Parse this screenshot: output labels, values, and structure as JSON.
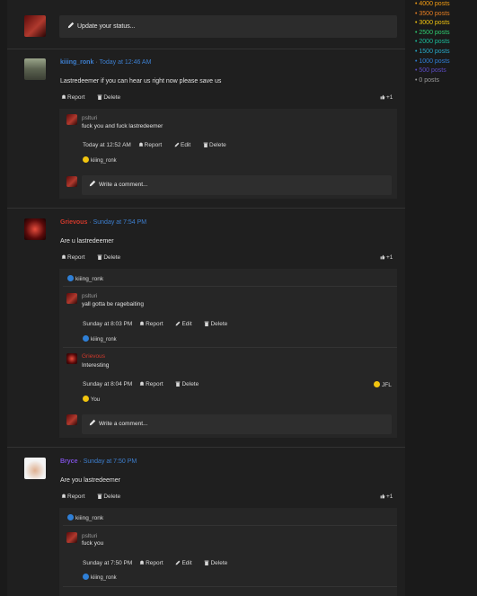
{
  "sidebar": {
    "post_ladder": [
      {
        "label": "• 4000 posts",
        "color": "#f39c12"
      },
      {
        "label": "• 3500 posts",
        "color": "#e67e22"
      },
      {
        "label": "• 3000 posts",
        "color": "#f1c40f"
      },
      {
        "label": "• 2500 posts",
        "color": "#2ecc71"
      },
      {
        "label": "• 2000 posts",
        "color": "#1abc9c"
      },
      {
        "label": "• 1500 posts",
        "color": "#27a9c7"
      },
      {
        "label": "• 1000 posts",
        "color": "#2f7fd6"
      },
      {
        "label": "• 500 posts",
        "color": "#5b4bc4"
      },
      {
        "label": "• 0 posts",
        "color": "#9a9a9a"
      }
    ]
  },
  "composer": {
    "status_placeholder": "Update your status..."
  },
  "labels": {
    "report": "Report",
    "delete": "Delete",
    "edit": "Edit",
    "write_comment": "Write a comment...",
    "separator": " · "
  },
  "posts": [
    {
      "author": "kiiing_ronk",
      "time": "Today at 12:46 AM",
      "text": "Lastredeemer if you can hear us right now please save us",
      "likes": "+1",
      "comments": [
        {
          "author": "pslturi",
          "text": "fuck you and fuck lastredeemer",
          "time": "Today at 12:52 AM",
          "liked_by": "kiiing_ronk"
        }
      ]
    },
    {
      "author": "Grievous",
      "time": "Sunday at 7:54 PM",
      "text": "Are u lastredeemer",
      "likes": "+1",
      "liked_by": "kiiing_ronk",
      "comments": [
        {
          "author": "pslturi",
          "text": "yall gotta be ragebaiting",
          "time": "Sunday at 8:03 PM",
          "liked_by": "kiiing_ronk"
        },
        {
          "author": "Grievous",
          "text": "Interesting",
          "time": "Sunday at 8:04 PM",
          "liked_by": "You",
          "reaction_count": "JFL"
        }
      ]
    },
    {
      "author": "Bryce",
      "time": "Sunday at 7:50 PM",
      "text": "Are you lastredeemer",
      "likes": "+1",
      "liked_by": "kiiing_ronk",
      "comments": [
        {
          "author": "pslturi",
          "text": "fuck you",
          "time": "Sunday at 7:50 PM",
          "liked_by": "kiiing_ronk"
        }
      ]
    }
  ],
  "colors": {
    "link": "#3d7fcf",
    "background": "#1a1a1a",
    "panel": "#1f1f1f",
    "comment_panel": "#262626"
  }
}
